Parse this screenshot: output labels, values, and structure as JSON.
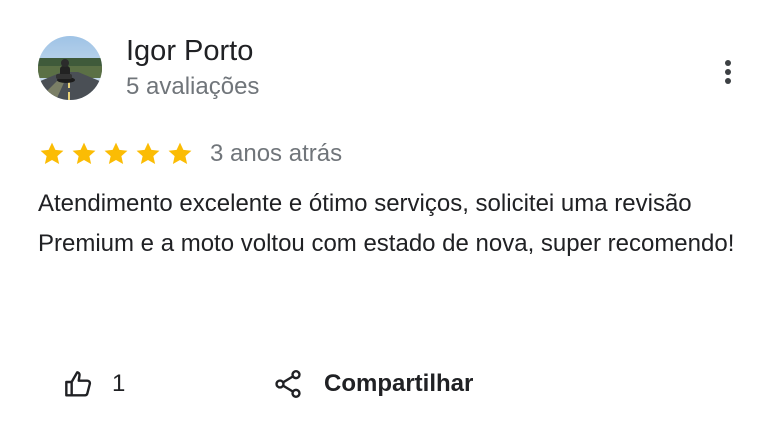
{
  "reviewer": {
    "name": "Igor Porto",
    "reviews_count": "5 avaliações"
  },
  "review": {
    "rating": 5,
    "rating_max": 5,
    "star_color": "#fbbc04",
    "date": "3 anos atrás",
    "text": "Atendimento excelente e ótimo serviços, solicitei uma revisão Premium e a moto voltou com estado de nova, super recomendo!"
  },
  "actions": {
    "like_icon": "thumb-up-icon",
    "like_count": "1",
    "share_icon": "share-icon",
    "share_label": "Compartilhar",
    "more_icon": "more-vert-icon"
  }
}
